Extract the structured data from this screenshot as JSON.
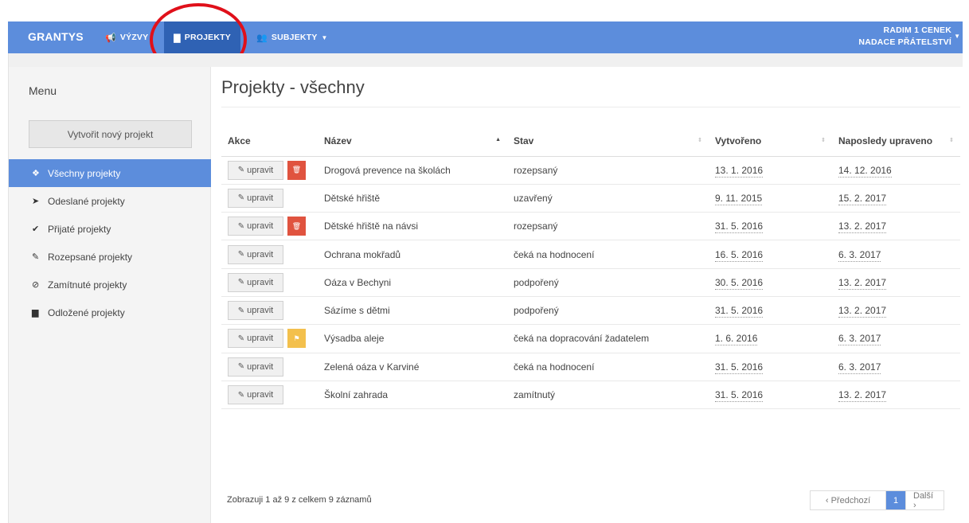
{
  "navbar": {
    "brand": "GRANTYS",
    "vyzvy": "VÝZVY",
    "projekty": "PROJEKTY",
    "subjekty": "SUBJEKTY",
    "user_name": "RADIM 1 CENEK",
    "user_org": "NADACE PŘÁTELSTVÍ"
  },
  "sidebar": {
    "title": "Menu",
    "new_project": "Vytvořit nový projekt",
    "items": [
      {
        "label": "Všechny projekty",
        "icon": "cubes-icon"
      },
      {
        "label": "Odeslané projekty",
        "icon": "paper-plane-icon"
      },
      {
        "label": "Přijaté projekty",
        "icon": "check-icon"
      },
      {
        "label": "Rozepsané projekty",
        "icon": "pencil-icon"
      },
      {
        "label": "Zamítnuté projekty",
        "icon": "ban-icon"
      },
      {
        "label": "Odložené projekty",
        "icon": "archive-icon"
      }
    ]
  },
  "main": {
    "title": "Projekty - všechny",
    "columns": [
      "Akce",
      "Název",
      "Stav",
      "Vytvořeno",
      "Naposledy upraveno"
    ],
    "edit_label": "upravit",
    "rows": [
      {
        "name": "Drogová prevence na školách",
        "state": "rozepsaný",
        "created": "13. 1. 2016",
        "updated": "14. 12. 2016",
        "extra": "delete"
      },
      {
        "name": "Dětské hřiště",
        "state": "uzavřený",
        "created": "9. 11. 2015",
        "updated": "15. 2. 2017",
        "extra": ""
      },
      {
        "name": "Dětské hřiště na návsi",
        "state": "rozepsaný",
        "created": "31. 5. 2016",
        "updated": "13. 2. 2017",
        "extra": "delete"
      },
      {
        "name": "Ochrana mokřadů",
        "state": "čeká na hodnocení",
        "created": "16. 5. 2016",
        "updated": "6. 3. 2017",
        "extra": ""
      },
      {
        "name": "Oáza v Bechyni",
        "state": "podpořený",
        "created": "30. 5. 2016",
        "updated": "13. 2. 2017",
        "extra": ""
      },
      {
        "name": "Sázíme s dětmi",
        "state": "podpořený",
        "created": "31. 5. 2016",
        "updated": "13. 2. 2017",
        "extra": ""
      },
      {
        "name": "Výsadba aleje",
        "state": "čeká na dopracování žadatelem",
        "created": "1. 6. 2016",
        "updated": "6. 3. 2017",
        "extra": "flag"
      },
      {
        "name": "Zelená oáza v Karviné",
        "state": "čeká na hodnocení",
        "created": "31. 5. 2016",
        "updated": "6. 3. 2017",
        "extra": ""
      },
      {
        "name": "Školní zahrada",
        "state": "zamítnutý",
        "created": "31. 5. 2016",
        "updated": "13. 2. 2017",
        "extra": ""
      }
    ],
    "info": "Zobrazuji 1 až 9 z celkem 9 záznamů",
    "pager": {
      "prev": "‹ Předchozí",
      "current": "1",
      "next": "Další ›"
    }
  },
  "colors": {
    "navbar": "#5c8ddc",
    "navbar_active": "#2f62b4",
    "delete": "#e0533f",
    "flag": "#f3c04d",
    "annotation": "#e0101a"
  }
}
